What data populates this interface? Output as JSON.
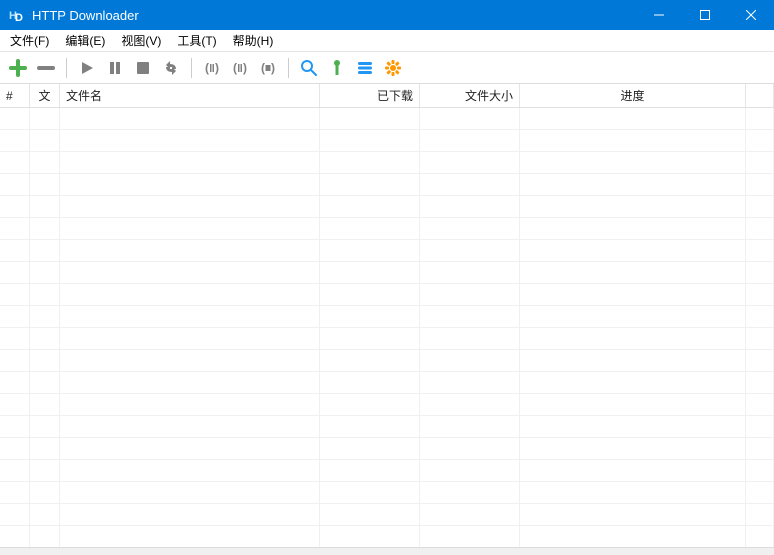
{
  "window": {
    "title": "HTTP Downloader"
  },
  "menu": {
    "file": "文件(F)",
    "edit": "编辑(E)",
    "view": "视图(V)",
    "tools": "工具(T)",
    "help": "帮助(H)"
  },
  "columns": {
    "num": "#",
    "type": "文",
    "name": "文件名",
    "downloaded": "已下载",
    "size": "文件大小",
    "progress": "进度"
  },
  "toolbar_icons": {
    "add": "add",
    "remove": "remove",
    "start": "start",
    "pause": "pause",
    "stop": "stop",
    "restart": "restart",
    "pause_active": "pause-active",
    "pause_inactive": "pause-inactive",
    "stop_all": "stop-all",
    "search": "search",
    "filter": "filter",
    "list": "list",
    "settings": "settings"
  },
  "colors": {
    "titlebar": "#0078d7",
    "green": "#4caf50",
    "gray": "#808080",
    "blue": "#2196f3",
    "orange": "#ff9800"
  },
  "rows": []
}
